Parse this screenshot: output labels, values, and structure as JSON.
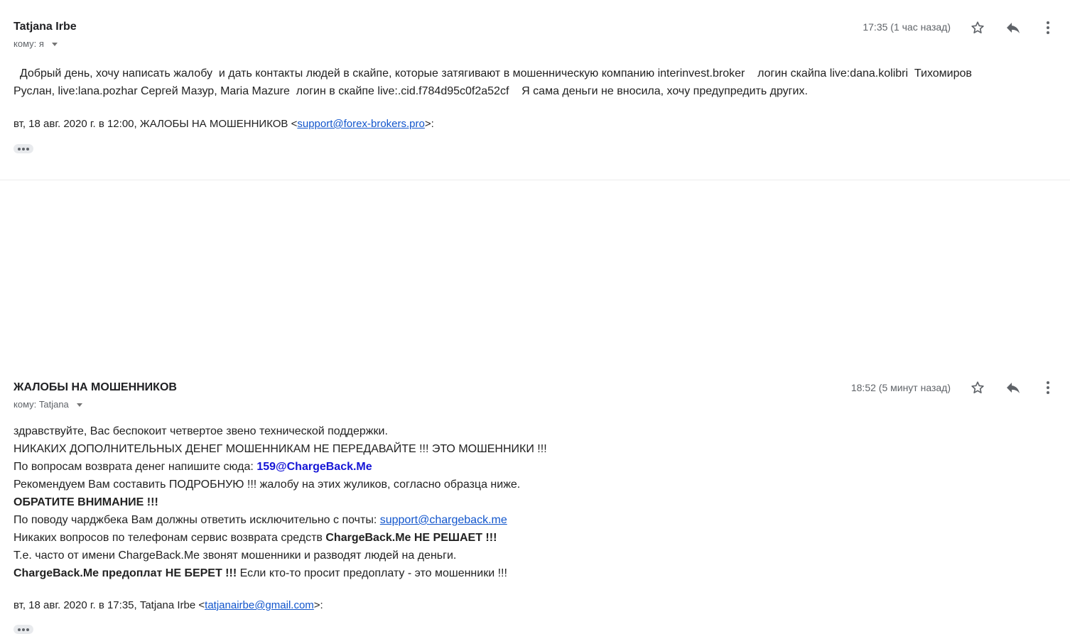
{
  "messages": [
    {
      "sender": "Tatjana Irbe",
      "to_label": "кому: я",
      "time": "17:35 (1 час назад)",
      "body_lines": [
        "  Добрый день, хочу написать жалобу  и дать контакты людей в скайпе, которые затягивают в мошенническую компанию interinvest.broker    логин скайпа live:dana.kolibri  Тихомиров",
        "Руслан, live:lana.pozhar Сергей Мазур, Maria Mazure  логин в скайпе live:.cid.f784d95c0f2a52cf    Я сама деньги не вносила, хочу предупредить других."
      ],
      "quote_prefix": "вт, 18 авг. 2020 г. в 12:00, ЖАЛОБЫ НА МОШЕННИКОВ <",
      "quote_email": "support@forex-brokers.pro",
      "quote_suffix": ">:"
    },
    {
      "sender": "ЖАЛОБЫ НА МОШЕННИКОВ",
      "to_label": "кому: Tatjana",
      "time": "18:52 (5 минут назад)",
      "lines": {
        "l1": "здравствуйте, Вас беспокоит четвертое звено технической поддержки.",
        "l2": "НИКАКИХ ДОПОЛНИТЕЛЬНЫХ ДЕНЕГ МОШЕННИКАМ НЕ ПЕРЕДАВАЙТЕ !!! ЭТО МОШЕННИКИ !!!",
        "l3_text": "По вопросам возврата денег напишите сюда: ",
        "l3_email": "159@ChargeBack.Me",
        "l4": "Рекомендуем Вам составить ПОДРОБНУЮ !!! жалобу на этих жуликов, согласно образца ниже.",
        "l5": "ОБРАТИТЕ ВНИМАНИЕ !!!",
        "l6_text": "По поводу чарджбека Вам должны ответить исключительно с почты: ",
        "l6_email": "support@chargeback.me",
        "l7_text": "Никаких вопросов по телефонам сервис возврата средств ",
        "l7_bold": "ChargeBack.Me НЕ РЕШАЕТ !!!",
        "l8": "Т.е. часто от имени ChargeBack.Me звонят мошенники и разводят людей на деньги.",
        "l9_bold": "ChargeBack.Me предоплат НЕ БЕРЕТ !!!",
        "l9_text": " Если кто-то просит предоплату - это мошенники !!!"
      },
      "quote_prefix": "вт, 18 авг. 2020 г. в 17:35, Tatjana Irbe <",
      "quote_email": "tatjanairbe@gmail.com",
      "quote_suffix": ">:"
    }
  ],
  "icons": {
    "star": "star-outline-icon",
    "reply": "reply-arrow-icon",
    "more": "more-vertical-icon",
    "color": "#5f6368"
  }
}
